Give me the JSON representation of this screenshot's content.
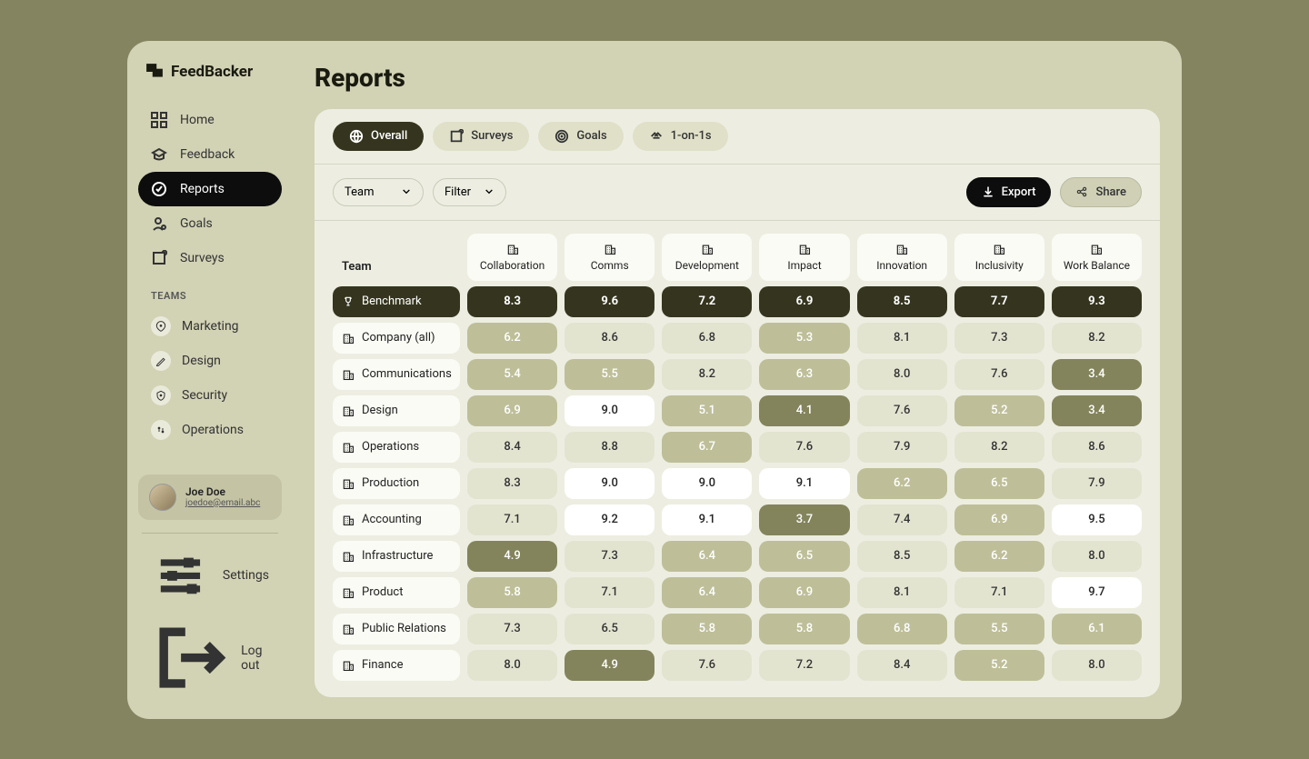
{
  "app_name": "FeedBacker",
  "page_title": "Reports",
  "nav": [
    {
      "key": "home",
      "label": "Home"
    },
    {
      "key": "feedback",
      "label": "Feedback"
    },
    {
      "key": "reports",
      "label": "Reports",
      "active": true
    },
    {
      "key": "goals",
      "label": "Goals"
    },
    {
      "key": "surveys",
      "label": "Surveys"
    }
  ],
  "teams_label": "TEAMS",
  "teams": [
    {
      "key": "marketing",
      "label": "Marketing"
    },
    {
      "key": "design",
      "label": "Design"
    },
    {
      "key": "security",
      "label": "Security"
    },
    {
      "key": "operations",
      "label": "Operations"
    }
  ],
  "user": {
    "name": "Joe Doe",
    "email": "joedoe@email.abc"
  },
  "footer": {
    "settings": "Settings",
    "logout": "Log out"
  },
  "tabs": [
    {
      "key": "overall",
      "label": "Overall",
      "active": true
    },
    {
      "key": "surveys",
      "label": "Surveys"
    },
    {
      "key": "goals",
      "label": "Goals"
    },
    {
      "key": "oneonones",
      "label": "1-on-1s"
    }
  ],
  "selects": {
    "team": "Team",
    "filter": "Filter"
  },
  "buttons": {
    "export": "Export",
    "share": "Share"
  },
  "table": {
    "row_header": "Team",
    "columns": [
      "Collaboration",
      "Comms",
      "Development",
      "Impact",
      "Innovation",
      "Inclusivity",
      "Work Balance"
    ],
    "benchmark_label": "Benchmark",
    "benchmark_values": [
      "8.3",
      "9.6",
      "7.2",
      "6.9",
      "8.5",
      "7.7",
      "9.3"
    ],
    "rows": [
      {
        "label": "Company (all)",
        "values": [
          {
            "v": "6.2",
            "s": 3
          },
          {
            "v": "8.6",
            "s": 4
          },
          {
            "v": "6.8",
            "s": 4
          },
          {
            "v": "5.3",
            "s": 3
          },
          {
            "v": "8.1",
            "s": 4
          },
          {
            "v": "7.3",
            "s": 4
          },
          {
            "v": "8.2",
            "s": 4
          }
        ]
      },
      {
        "label": "Communications",
        "values": [
          {
            "v": "5.4",
            "s": 3
          },
          {
            "v": "5.5",
            "s": 3
          },
          {
            "v": "8.2",
            "s": 4
          },
          {
            "v": "6.3",
            "s": 3
          },
          {
            "v": "8.0",
            "s": 4
          },
          {
            "v": "7.6",
            "s": 4
          },
          {
            "v": "3.4",
            "s": 1
          }
        ]
      },
      {
        "label": "Design",
        "values": [
          {
            "v": "6.9",
            "s": 3
          },
          {
            "v": "9.0",
            "s": 5
          },
          {
            "v": "5.1",
            "s": 3
          },
          {
            "v": "4.1",
            "s": 1
          },
          {
            "v": "7.6",
            "s": 4
          },
          {
            "v": "5.2",
            "s": 3
          },
          {
            "v": "3.4",
            "s": 1
          }
        ]
      },
      {
        "label": "Operations",
        "values": [
          {
            "v": "8.4",
            "s": 4
          },
          {
            "v": "8.8",
            "s": 4
          },
          {
            "v": "6.7",
            "s": 3
          },
          {
            "v": "7.6",
            "s": 4
          },
          {
            "v": "7.9",
            "s": 4
          },
          {
            "v": "8.2",
            "s": 4
          },
          {
            "v": "8.6",
            "s": 4
          }
        ]
      },
      {
        "label": "Production",
        "values": [
          {
            "v": "8.3",
            "s": 4
          },
          {
            "v": "9.0",
            "s": 5
          },
          {
            "v": "9.0",
            "s": 5
          },
          {
            "v": "9.1",
            "s": 5
          },
          {
            "v": "6.2",
            "s": 3
          },
          {
            "v": "6.5",
            "s": 3
          },
          {
            "v": "7.9",
            "s": 4
          }
        ]
      },
      {
        "label": "Accounting",
        "values": [
          {
            "v": "7.1",
            "s": 4
          },
          {
            "v": "9.2",
            "s": 5
          },
          {
            "v": "9.1",
            "s": 5
          },
          {
            "v": "3.7",
            "s": 1
          },
          {
            "v": "7.4",
            "s": 4
          },
          {
            "v": "6.9",
            "s": 3
          },
          {
            "v": "9.5",
            "s": 5
          }
        ]
      },
      {
        "label": "Infrastructure",
        "values": [
          {
            "v": "4.9",
            "s": 1
          },
          {
            "v": "7.3",
            "s": 4
          },
          {
            "v": "6.4",
            "s": 3
          },
          {
            "v": "6.5",
            "s": 3
          },
          {
            "v": "8.5",
            "s": 4
          },
          {
            "v": "6.2",
            "s": 3
          },
          {
            "v": "8.0",
            "s": 4
          }
        ]
      },
      {
        "label": "Product",
        "values": [
          {
            "v": "5.8",
            "s": 3
          },
          {
            "v": "7.1",
            "s": 4
          },
          {
            "v": "6.4",
            "s": 3
          },
          {
            "v": "6.9",
            "s": 3
          },
          {
            "v": "8.1",
            "s": 4
          },
          {
            "v": "7.1",
            "s": 4
          },
          {
            "v": "9.7",
            "s": 5
          }
        ]
      },
      {
        "label": "Public Relations",
        "values": [
          {
            "v": "7.3",
            "s": 4
          },
          {
            "v": "6.5",
            "s": 4
          },
          {
            "v": "5.8",
            "s": 3
          },
          {
            "v": "5.8",
            "s": 3
          },
          {
            "v": "6.8",
            "s": 3
          },
          {
            "v": "5.5",
            "s": 3
          },
          {
            "v": "6.1",
            "s": 3
          }
        ]
      },
      {
        "label": "Finance",
        "values": [
          {
            "v": "8.0",
            "s": 4
          },
          {
            "v": "4.9",
            "s": 1
          },
          {
            "v": "7.6",
            "s": 4
          },
          {
            "v": "7.2",
            "s": 4
          },
          {
            "v": "8.4",
            "s": 4
          },
          {
            "v": "5.2",
            "s": 3
          },
          {
            "v": "8.0",
            "s": 4
          }
        ]
      }
    ]
  },
  "chart_data": {
    "type": "table",
    "title": "Reports – Overall",
    "columns": [
      "Collaboration",
      "Comms",
      "Development",
      "Impact",
      "Innovation",
      "Inclusivity",
      "Work Balance"
    ],
    "rows": [
      {
        "label": "Benchmark",
        "values": [
          8.3,
          9.6,
          7.2,
          6.9,
          8.5,
          7.7,
          9.3
        ]
      },
      {
        "label": "Company (all)",
        "values": [
          6.2,
          8.6,
          6.8,
          5.3,
          8.1,
          7.3,
          8.2
        ]
      },
      {
        "label": "Communications",
        "values": [
          5.4,
          5.5,
          8.2,
          6.3,
          8.0,
          7.6,
          3.4
        ]
      },
      {
        "label": "Design",
        "values": [
          6.9,
          9.0,
          5.1,
          4.1,
          7.6,
          5.2,
          3.4
        ]
      },
      {
        "label": "Operations",
        "values": [
          8.4,
          8.8,
          6.7,
          7.6,
          7.9,
          8.2,
          8.6
        ]
      },
      {
        "label": "Production",
        "values": [
          8.3,
          9.0,
          9.0,
          9.1,
          6.2,
          6.5,
          7.9
        ]
      },
      {
        "label": "Accounting",
        "values": [
          7.1,
          9.2,
          9.1,
          3.7,
          7.4,
          6.9,
          9.5
        ]
      },
      {
        "label": "Infrastructure",
        "values": [
          4.9,
          7.3,
          6.4,
          6.5,
          8.5,
          6.2,
          8.0
        ]
      },
      {
        "label": "Product",
        "values": [
          5.8,
          7.1,
          6.4,
          6.9,
          8.1,
          7.1,
          9.7
        ]
      },
      {
        "label": "Public Relations",
        "values": [
          7.3,
          6.5,
          5.8,
          5.8,
          6.8,
          5.5,
          6.1
        ]
      },
      {
        "label": "Finance",
        "values": [
          8.0,
          4.9,
          7.6,
          7.2,
          8.4,
          5.2,
          8.0
        ]
      }
    ]
  }
}
